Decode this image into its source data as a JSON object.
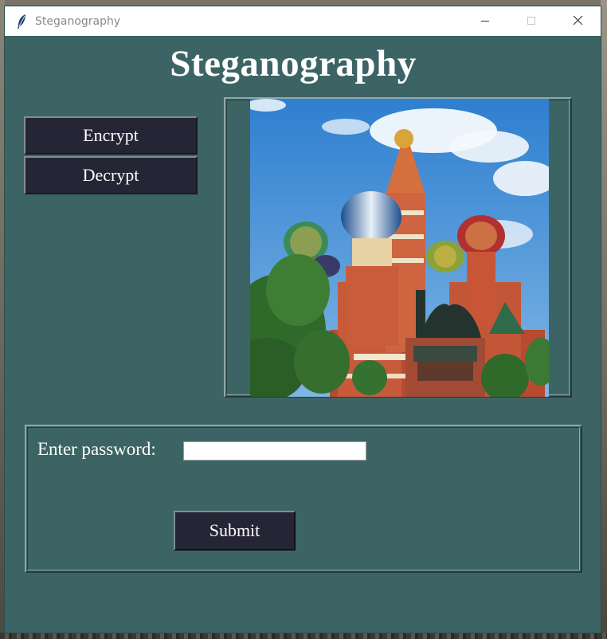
{
  "window": {
    "title": "Steganography",
    "app_icon": "feather-icon",
    "controls": [
      "minimize-icon",
      "maximize-icon",
      "close-icon"
    ]
  },
  "main": {
    "heading": "Steganography",
    "buttons": {
      "encrypt_label": "Encrypt",
      "decrypt_label": "Decrypt"
    },
    "image": {
      "description_icon": "cathedral-photo"
    },
    "password_panel": {
      "label": "Enter password:",
      "input_value": "",
      "submit_label": "Submit"
    }
  },
  "colors": {
    "window_bg": "#3d6464",
    "button_bg": "#252536",
    "text": "#ffffff"
  }
}
